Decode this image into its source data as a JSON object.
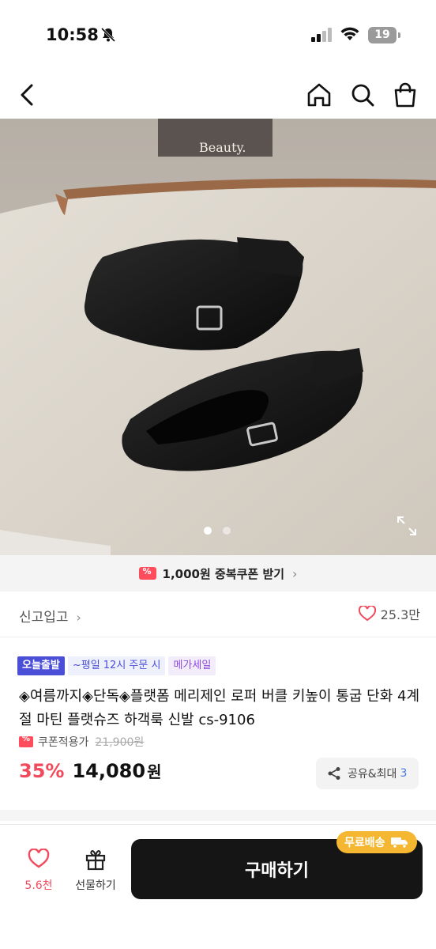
{
  "status_bar": {
    "time": "10:58",
    "battery": "19"
  },
  "hero": {
    "page_count": 2,
    "current_page": 1,
    "wall_card_text": "Beauty."
  },
  "coupon_bar": {
    "label": "1,000원 중복쿠폰 받기",
    "arrow": "›"
  },
  "store": {
    "name": "신고입고",
    "arrow": "›",
    "likes": "25.3만"
  },
  "badges": [
    "오늘출발",
    "~평일 12시 주문 시",
    "메가세일"
  ],
  "product": {
    "title": "◈여름까지◈단독◈플랫폼 메리제인 로퍼 버클 키높이 통굽 단화 4계절 마틴 플랫슈즈 하객룩 신발 cs-9106",
    "coupon_label": "쿠폰적용가",
    "original_price": "21,900원",
    "discount": "35%",
    "price": "14,080",
    "currency": "원"
  },
  "share": {
    "label": "공유&최대",
    "count": "3"
  },
  "bottom_bar": {
    "like_count": "5.6천",
    "gift_label": "선물하기",
    "buy_label": "구매하기",
    "free_ship_label": "무료배송"
  },
  "colors": {
    "accent_red": "#f04a5c",
    "badge_blue": "#4b4fd8",
    "free_ship_yellow": "#f5b731",
    "buy_button": "#151515"
  }
}
